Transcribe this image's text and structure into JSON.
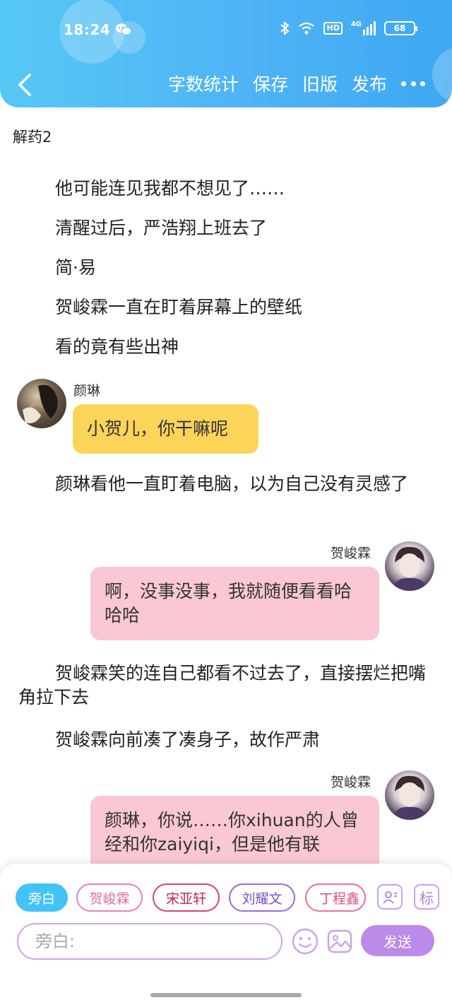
{
  "status_bar": {
    "time": "18:24",
    "hd": "HD",
    "network": "4G",
    "battery": "68",
    "icons": [
      "wechat-icon",
      "bluetooth-icon",
      "wifi-icon",
      "signal-icon",
      "battery-icon"
    ]
  },
  "toolbar": {
    "back_icon": "chevron-left-icon",
    "actions": [
      "字数统计",
      "保存",
      "旧版",
      "发布"
    ],
    "more_icon": "more-dots-icon"
  },
  "document": {
    "title": "解药2",
    "paragraphs_1": [
      "他可能连见我都不想见了……",
      "清醒过后，严浩翔上班去了",
      "简·易",
      "贺峻霖一直在盯着屏幕上的壁纸",
      "看的竟有些出神"
    ],
    "msg_1": {
      "speaker": "颜琳",
      "text": "小贺儿，你干嘛呢"
    },
    "paragraph_2": "颜琳看他一直盯着电脑，以为自己没有灵感了",
    "msg_2": {
      "speaker": "贺峻霖",
      "text": "啊，没事没事，我就随便看看哈哈哈"
    },
    "paragraph_3": "贺峻霖笑的连自己都看不过去了，直接摆烂把嘴角拉下去",
    "paragraph_4": "贺峻霖向前凑了凑身子，故作严肃",
    "msg_3": {
      "speaker": "贺峻霖",
      "text": "颜琳，你说……你xihuan的人曾经和你zaiyiqi，但是他有联"
    }
  },
  "composer": {
    "roles": [
      "旁白",
      "贺峻霖",
      "宋亚轩",
      "刘耀文",
      "丁程鑫"
    ],
    "role_icon": "person-card-icon",
    "tag_label": "标",
    "input_placeholder": "旁白:",
    "emoji_icon": "emoji-icon",
    "image_icon": "image-icon",
    "send_label": "发送"
  },
  "colors": {
    "header_blue": "#4fb3f5",
    "narration_chip": "#43c3f4",
    "yellow_bubble": "#fdd45a",
    "pink_bubble": "#f9c8d4",
    "send_button": "#bc8ae8"
  }
}
